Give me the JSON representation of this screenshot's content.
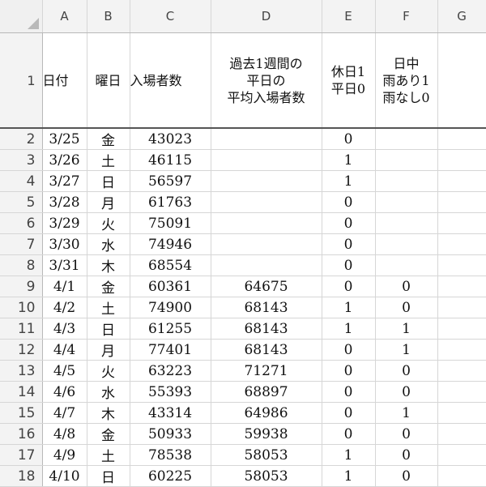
{
  "columns": [
    "A",
    "B",
    "C",
    "D",
    "E",
    "F",
    "G"
  ],
  "header_row": {
    "row_number": "1",
    "date": "日付",
    "weekday": "曜日",
    "visitors": "入場者数",
    "weekday_avg_line1": "過去1週間の",
    "weekday_avg_line2": "平日の",
    "weekday_avg_line3": "平均入場者数",
    "holiday_line1": "休日1",
    "holiday_line2": "平日0",
    "rain_line1": "日中",
    "rain_line2": "雨あり1",
    "rain_line3": "雨なし0"
  },
  "rows": [
    {
      "n": "2",
      "date": "3/25",
      "day": "金",
      "visitors": "43023",
      "avg": "",
      "holiday": "0",
      "rain": ""
    },
    {
      "n": "3",
      "date": "3/26",
      "day": "土",
      "visitors": "46115",
      "avg": "",
      "holiday": "1",
      "rain": ""
    },
    {
      "n": "4",
      "date": "3/27",
      "day": "日",
      "visitors": "56597",
      "avg": "",
      "holiday": "1",
      "rain": ""
    },
    {
      "n": "5",
      "date": "3/28",
      "day": "月",
      "visitors": "61763",
      "avg": "",
      "holiday": "0",
      "rain": ""
    },
    {
      "n": "6",
      "date": "3/29",
      "day": "火",
      "visitors": "75091",
      "avg": "",
      "holiday": "0",
      "rain": ""
    },
    {
      "n": "7",
      "date": "3/30",
      "day": "水",
      "visitors": "74946",
      "avg": "",
      "holiday": "0",
      "rain": ""
    },
    {
      "n": "8",
      "date": "3/31",
      "day": "木",
      "visitors": "68554",
      "avg": "",
      "holiday": "0",
      "rain": ""
    },
    {
      "n": "9",
      "date": "4/1",
      "day": "金",
      "visitors": "60361",
      "avg": "64675",
      "holiday": "0",
      "rain": "0"
    },
    {
      "n": "10",
      "date": "4/2",
      "day": "土",
      "visitors": "74900",
      "avg": "68143",
      "holiday": "1",
      "rain": "0"
    },
    {
      "n": "11",
      "date": "4/3",
      "day": "日",
      "visitors": "61255",
      "avg": "68143",
      "holiday": "1",
      "rain": "1"
    },
    {
      "n": "12",
      "date": "4/4",
      "day": "月",
      "visitors": "77401",
      "avg": "68143",
      "holiday": "0",
      "rain": "1"
    },
    {
      "n": "13",
      "date": "4/5",
      "day": "火",
      "visitors": "63223",
      "avg": "71271",
      "holiday": "0",
      "rain": "0"
    },
    {
      "n": "14",
      "date": "4/6",
      "day": "水",
      "visitors": "55393",
      "avg": "68897",
      "holiday": "0",
      "rain": "0"
    },
    {
      "n": "15",
      "date": "4/7",
      "day": "木",
      "visitors": "43314",
      "avg": "64986",
      "holiday": "0",
      "rain": "1"
    },
    {
      "n": "16",
      "date": "4/8",
      "day": "金",
      "visitors": "50933",
      "avg": "59938",
      "holiday": "0",
      "rain": "0"
    },
    {
      "n": "17",
      "date": "4/9",
      "day": "土",
      "visitors": "78538",
      "avg": "58053",
      "holiday": "1",
      "rain": "0"
    },
    {
      "n": "18",
      "date": "4/10",
      "day": "日",
      "visitors": "60225",
      "avg": "58053",
      "holiday": "1",
      "rain": "0"
    }
  ]
}
